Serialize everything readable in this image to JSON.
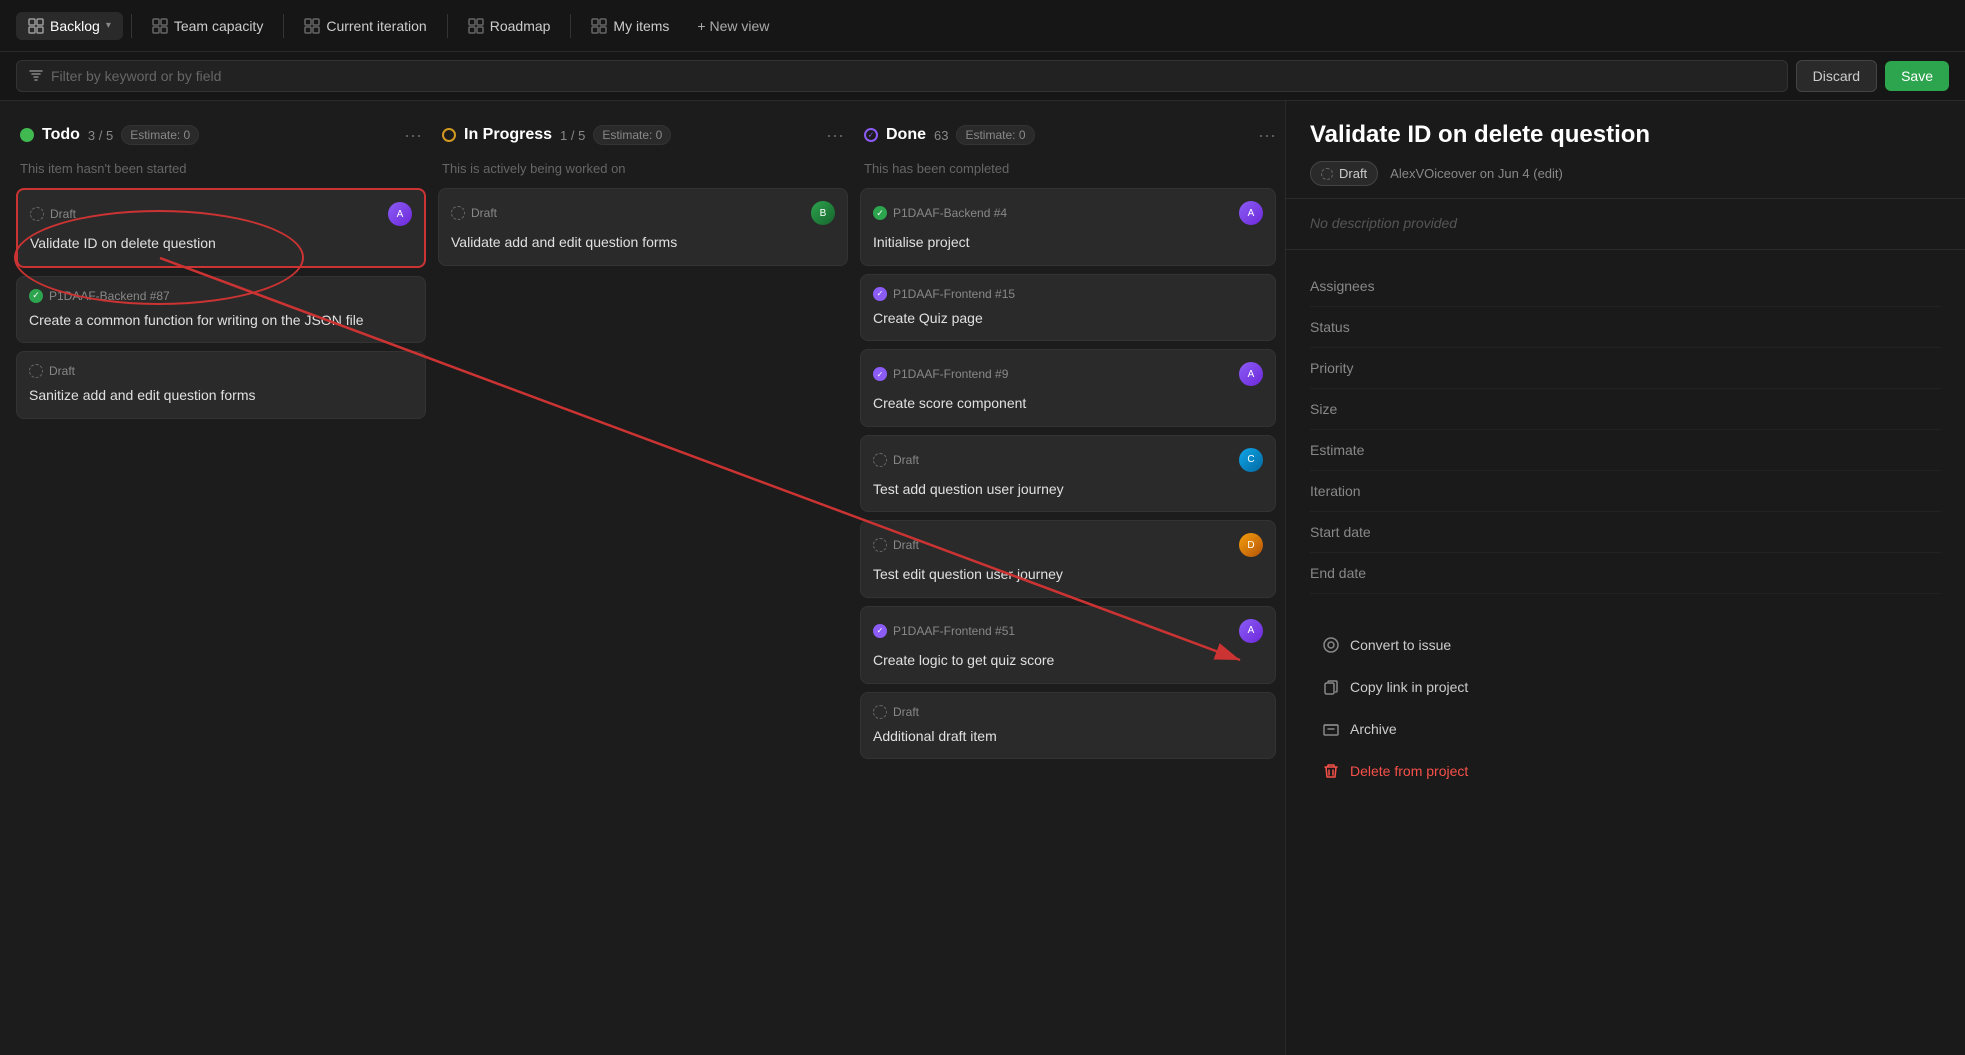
{
  "topNav": {
    "backlog": "Backlog",
    "teamCapacity": "Team capacity",
    "currentIteration": "Current iteration",
    "roadmap": "Roadmap",
    "myItems": "My items",
    "newView": "+ New view"
  },
  "filterBar": {
    "placeholder": "Filter by keyword or by field",
    "discard": "Discard",
    "save": "Save"
  },
  "columns": {
    "todo": {
      "title": "Todo",
      "count": "3 / 5",
      "estimate": "Estimate: 0",
      "description": "This item hasn't been started",
      "cards": [
        {
          "label": "Draft",
          "title": "Validate ID on delete question",
          "isDraft": true,
          "highlighted": true
        },
        {
          "label": "P1DAAF-Backend #87",
          "title": "Create a common function for writing on the JSON file",
          "isDraft": false,
          "type": "backend"
        },
        {
          "label": "Draft",
          "title": "Sanitize add and edit question forms",
          "isDraft": true
        }
      ]
    },
    "inprogress": {
      "title": "In Progress",
      "count": "1 / 5",
      "estimate": "Estimate: 0",
      "description": "This is actively being worked on",
      "cards": [
        {
          "label": "Draft",
          "title": "Validate add and edit question forms",
          "isDraft": true
        }
      ]
    },
    "done": {
      "title": "Done",
      "count": "63",
      "estimate": "Estimate: 0",
      "description": "This has been completed",
      "cards": [
        {
          "label": "P1DAAF-Backend #4",
          "title": "Initialise project",
          "isDraft": false,
          "type": "backend"
        },
        {
          "label": "P1DAAF-Frontend #15",
          "title": "Create Quiz page",
          "isDraft": false,
          "type": "frontend"
        },
        {
          "label": "P1DAAF-Frontend #9",
          "title": "Create score component",
          "isDraft": false,
          "type": "frontend"
        },
        {
          "label": "Draft",
          "title": "Test add question user journey",
          "isDraft": true
        },
        {
          "label": "Draft",
          "title": "Test edit question user journey",
          "isDraft": true
        },
        {
          "label": "P1DAAF-Frontend #51",
          "title": "Create logic to get quiz score",
          "isDraft": false,
          "type": "frontend"
        },
        {
          "label": "Draft",
          "title": "Additional draft item",
          "isDraft": true
        }
      ]
    }
  },
  "rightPanel": {
    "title": "Validate ID on de",
    "fullTitle": "Validate ID on delete question",
    "draftBadge": "Draft",
    "author": "AlexVOiceover c",
    "authorFull": "AlexVOiceover on Jun 4 (edit)",
    "noDescription": "No description provided",
    "fields": {
      "assignees": "Assignees",
      "status": "Status",
      "priority": "Priority",
      "size": "Size",
      "estimate": "Estimate",
      "iteration": "Iteration",
      "startDate": "Start date",
      "endDate": "End date"
    },
    "actions": {
      "convertToIssue": "Convert to issue",
      "copyLinkInProject": "Copy link in project",
      "archive": "Archive",
      "deleteFromProject": "Delete from project"
    }
  }
}
